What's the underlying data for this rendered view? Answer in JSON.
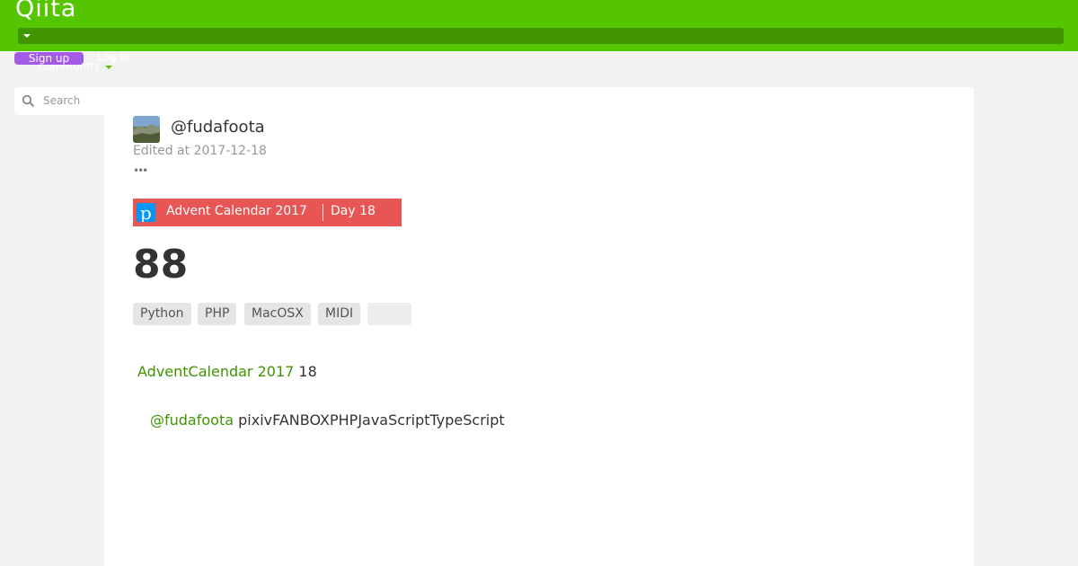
{
  "header": {
    "logo": "Qiita",
    "signup_label": "Sign up",
    "login_label": "Log in",
    "community_label": "Community"
  },
  "search": {
    "placeholder": "Search"
  },
  "article": {
    "author": "@fudafoota",
    "edited": "Edited at 2017-12-18",
    "advent": {
      "title": "Advent Calendar 2017",
      "day": "Day 18"
    },
    "title": "88",
    "tags": [
      "Python",
      "PHP",
      "MacOSX",
      "MIDI",
      ""
    ],
    "paragraph1": {
      "link": "AdventCalendar 2017",
      "rest": "18"
    },
    "paragraph2": {
      "link": "@fudafoota",
      "rest": "pixivFANBOXPHPJavaScriptTypeScript"
    }
  },
  "colors": {
    "brand": "#55c500",
    "signup": "#a35ae6",
    "advent": "#e85555",
    "link": "#3f9400"
  }
}
